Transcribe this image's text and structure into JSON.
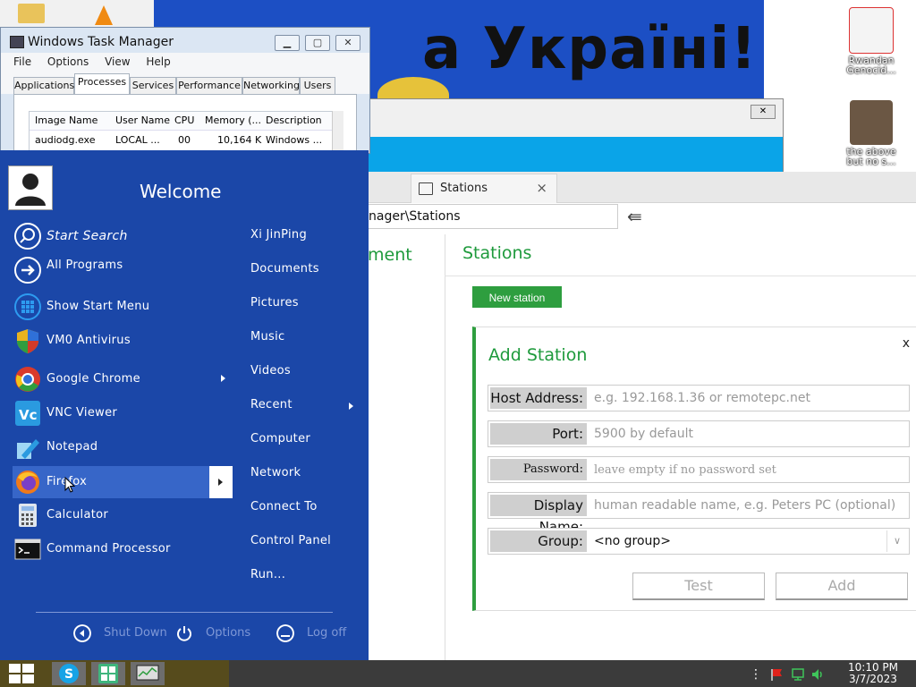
{
  "wallpaper": {
    "banner_text": "а Україні!"
  },
  "desktop_icons": [
    {
      "label": "Rwandan Genocid..."
    },
    {
      "label": "the above but no s..."
    }
  ],
  "task_manager": {
    "title": "Windows Task Manager",
    "menu": [
      "File",
      "Options",
      "View",
      "Help"
    ],
    "tabs": [
      "Applications",
      "Processes",
      "Services",
      "Performance",
      "Networking",
      "Users"
    ],
    "active_tab": "Processes",
    "columns": [
      "Image Name",
      "User Name",
      "CPU",
      "Memory (...",
      "Description"
    ],
    "rows": [
      [
        "audiodg.exe",
        "LOCAL ...",
        "00",
        "10,164 K",
        "Windows ..."
      ]
    ]
  },
  "app": {
    "tab_label": "Stations",
    "address": "nager\\Stations",
    "sidebar_title": "ment",
    "page_title": "Stations",
    "new_station_label": "New station",
    "panel": {
      "title": "Add Station",
      "close": "x",
      "fields": {
        "host": {
          "label": "Host Address:",
          "placeholder": "e.g. 192.168.1.36 or remotepc.net"
        },
        "port": {
          "label": "Port:",
          "placeholder": "5900 by default"
        },
        "password": {
          "label": "Password:",
          "placeholder": "leave empty if no password set"
        },
        "display": {
          "label": "Display Name:",
          "placeholder": "human readable name, e.g. Peters PC (optional)"
        },
        "group": {
          "label": "Group:",
          "value": "<no group>"
        }
      },
      "test_label": "Test",
      "add_label": "Add"
    }
  },
  "start_menu": {
    "welcome": "Welcome",
    "left_items": [
      {
        "label": "Start Search"
      },
      {
        "label": "All Programs"
      },
      {
        "label": "Show Start Menu"
      },
      {
        "label": "VM0 Antivirus"
      },
      {
        "label": "Google Chrome"
      },
      {
        "label": "VNC Viewer"
      },
      {
        "label": "Notepad"
      },
      {
        "label": "Firefox"
      },
      {
        "label": "Calculator"
      },
      {
        "label": "Command Processor"
      }
    ],
    "right_items": [
      "Xi JinPing",
      "Documents",
      "Pictures",
      "Music",
      "Videos",
      "Recent",
      "Computer",
      "Network",
      "Connect To",
      "Control Panel",
      "Run..."
    ],
    "bottom": {
      "shutdown": "Shut Down",
      "options": "Options",
      "logoff": "Log off"
    }
  },
  "taskbar": {
    "time": "10:10 PM",
    "date": "3/7/2023"
  },
  "colors": {
    "start_menu_bg": "#1b47a8",
    "accent_green": "#2e9e3f",
    "wallpaper_blue": "#1c4fc4",
    "taskbar_bg": "#3b3b3b"
  }
}
